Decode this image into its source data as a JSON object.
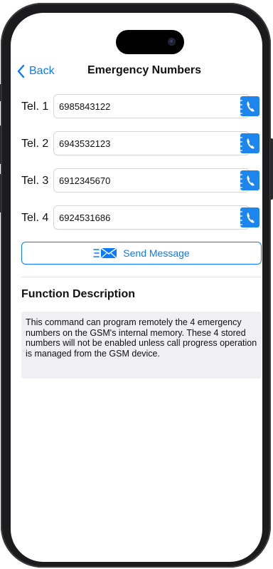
{
  "nav": {
    "back_label": "Back",
    "title": "Emergency Numbers"
  },
  "rows": [
    {
      "label": "Tel. 1",
      "value": "6985843122"
    },
    {
      "label": "Tel. 2",
      "value": "6943532123"
    },
    {
      "label": "Tel. 3",
      "value": "6912345670"
    },
    {
      "label": "Tel. 4",
      "value": "6924531686"
    }
  ],
  "send": {
    "label": "Send Message"
  },
  "function": {
    "title": "Function Description",
    "description": "This command can program remotely the 4 emergency numbers on the GSM's internal memory. These 4 stored numbers will not be enabled unless call progress operation is managed from the GSM device."
  },
  "colors": {
    "accent": "#0a7aff",
    "phone_icon_bg": "#1c86ee",
    "description_bg": "#efeff4"
  },
  "icons": {
    "back": "chevron-left-icon",
    "call": "phone-book-icon",
    "send": "envelope-icon"
  }
}
